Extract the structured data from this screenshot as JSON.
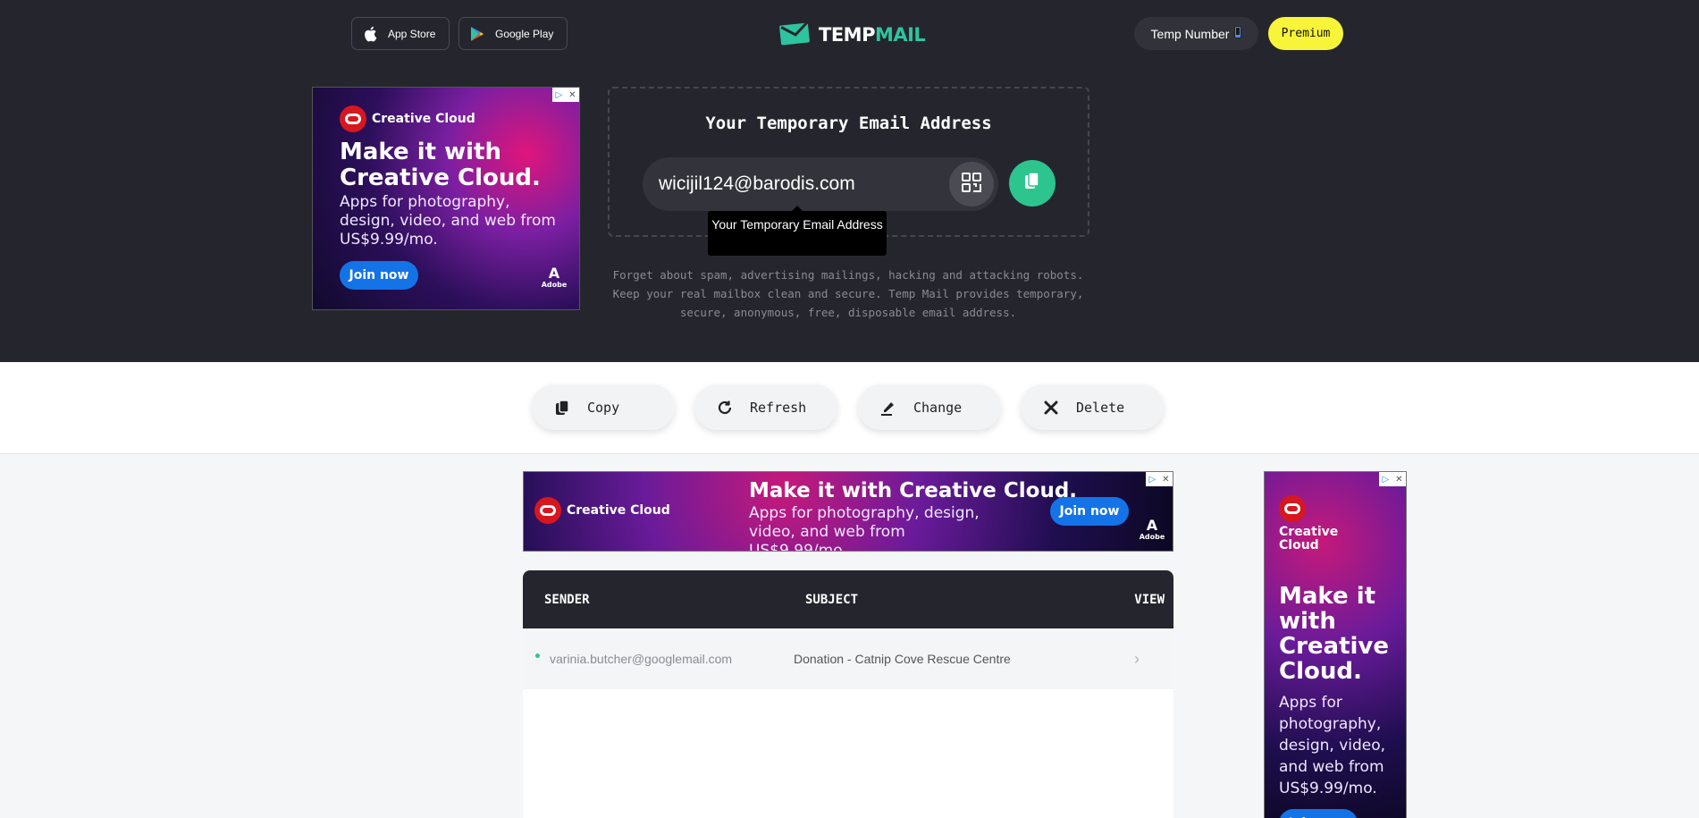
{
  "header": {
    "store_buttons": [
      {
        "label": "App Store",
        "icon": "apple-icon"
      },
      {
        "label": "Google Play",
        "icon": "google-play-icon"
      }
    ],
    "logo": {
      "part1": "TEMP",
      "part2": "MAIL",
      "icon": "envelope-icon"
    },
    "temp_number_label": "Temp Number",
    "temp_number_icon": "phone-icon",
    "premium_label": "Premium"
  },
  "email_section": {
    "heading": "Your Temporary Email Address",
    "email_value": "wicijil124@barodis.com",
    "tooltip": "Your Temporary Email Address",
    "tagline": "Forget about spam, advertising mailings, hacking and attacking robots. Keep your real mailbox clean and secure. Temp Mail provides temporary, secure, anonymous, free, disposable email address."
  },
  "actions": [
    {
      "label": "Copy",
      "icon": "copy-icon"
    },
    {
      "label": "Refresh",
      "icon": "refresh-icon"
    },
    {
      "label": "Change",
      "icon": "edit-icon"
    },
    {
      "label": "Delete",
      "icon": "close-icon"
    }
  ],
  "ads": {
    "brand": "Creative Cloud",
    "headline": "Make it with Creative Cloud.",
    "sub": "Apps for photography, design, video, and web from US$9.99/mo.",
    "sub_vertical": "Apps for photography, design, video, and web from US$9.99/mo.",
    "join": "Join now",
    "adobe": "Adobe"
  },
  "inbox": {
    "columns": {
      "sender": "SENDER",
      "subject": "SUBJECT",
      "view": "VIEW"
    },
    "messages": [
      {
        "sender": "varinia.butcher@googlemail.com",
        "subject": "Donation - Catnip Cove Rescue Centre",
        "unread": true
      }
    ]
  },
  "colors": {
    "dark_bg": "#25262d",
    "accent_green": "#2ec48e",
    "premium_yellow": "#f8f43a"
  }
}
